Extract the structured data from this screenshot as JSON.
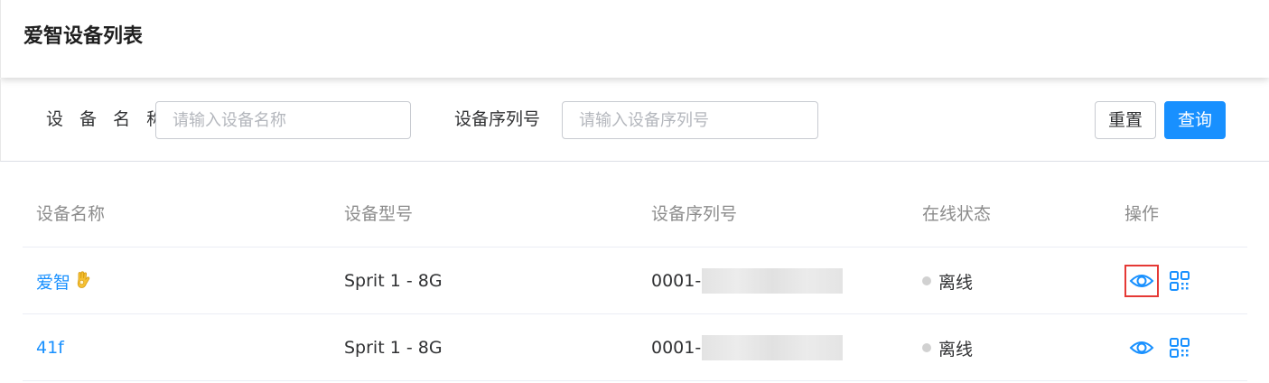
{
  "header": {
    "title": "爱智设备列表"
  },
  "filter": {
    "name_label": "设 备 名 称",
    "name_placeholder": "请输入设备名称",
    "serial_label": "设备序列号",
    "serial_placeholder": "请输入设备序列号",
    "reset_label": "重置",
    "query_label": "查询"
  },
  "table": {
    "columns": [
      "设备名称",
      "设备型号",
      "设备序列号",
      "在线状态",
      "操作"
    ],
    "rows": [
      {
        "name": "爱智",
        "name_icon": "ok-hand-emoji-icon",
        "model": "Sprit 1 - 8G",
        "serial_prefix": "0001-",
        "status": "离线"
      },
      {
        "name": "41f",
        "model": "Sprit 1 - 8G",
        "serial_prefix": "0001-",
        "status": "离线"
      }
    ]
  },
  "colors": {
    "primary": "#1890ff",
    "offline_dot": "#d1d1d1",
    "focus_border": "#e53935"
  },
  "icons": {
    "view": "eye-icon",
    "qrcode": "qrcode-icon"
  }
}
